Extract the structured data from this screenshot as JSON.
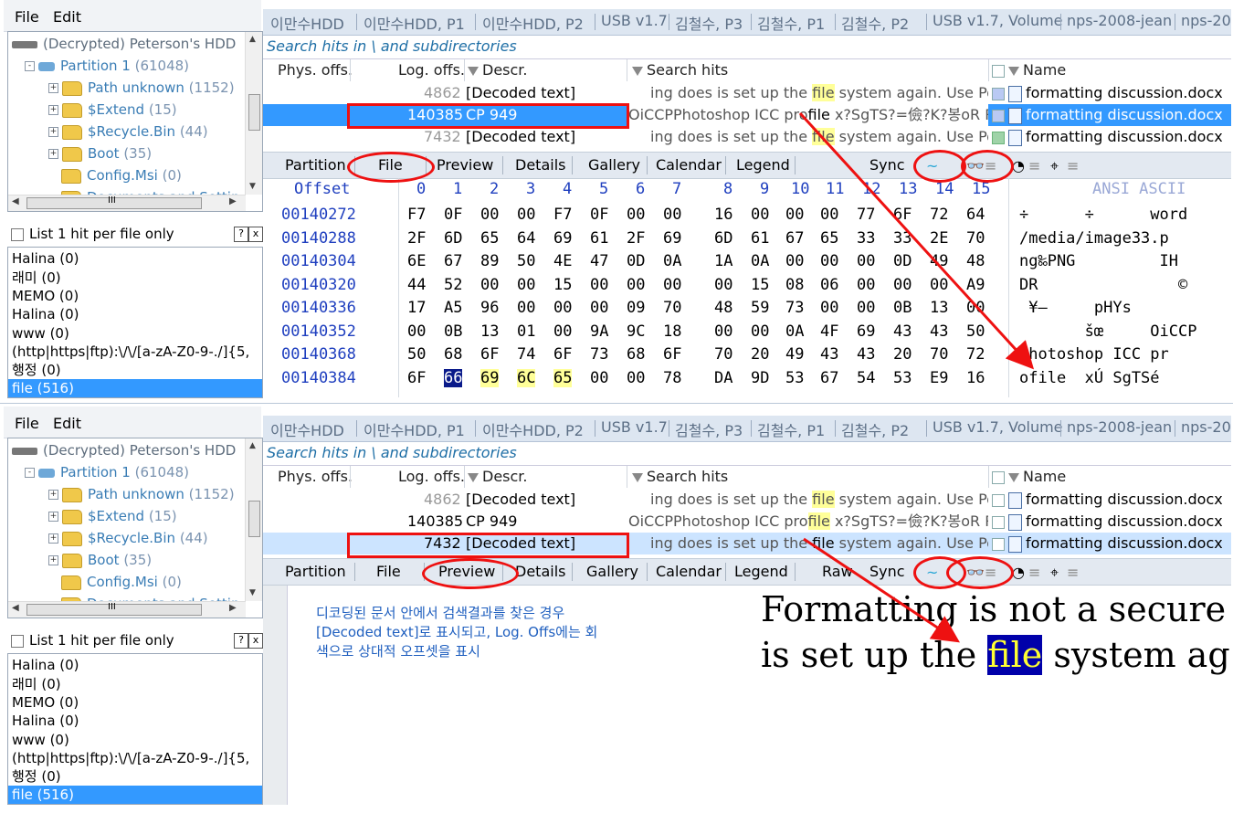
{
  "menu": {
    "file": "File",
    "edit": "Edit"
  },
  "tree": {
    "items": [
      {
        "label": "(Decrypted) Peterson's HDD",
        "count": ""
      },
      {
        "label": "Partition 1",
        "count": "(61048)"
      },
      {
        "label": "Path unknown",
        "count": "(1152)"
      },
      {
        "label": "$Extend",
        "count": "(15)"
      },
      {
        "label": "$Recycle.Bin",
        "count": "(44)"
      },
      {
        "label": "Boot",
        "count": "(35)"
      },
      {
        "label": "Config.Msi",
        "count": "(0)"
      },
      {
        "label": "Documents and Settin",
        "count": ""
      }
    ],
    "hscroll_label": "III"
  },
  "options": {
    "list_one_hit": "List 1 hit per file only",
    "help": "?",
    "close": "x"
  },
  "terms": [
    "Halina (0)",
    "래미 (0)",
    "MEMO (0)",
    "Halina (0)",
    "www (0)",
    "(http|https|ftp):\\/\\/[a-zA-Z0-9-./]{5,",
    "행정 (0)",
    "file (516)"
  ],
  "tabs": [
    "이만수HDD",
    "이만수HDD, P1",
    "이만수HDD, P2",
    "USB v1.7",
    "김철수, P3",
    "김철수, P1",
    "김철수, P2",
    "USB v1.7, Volume",
    "nps-2008-jean",
    "nps-20"
  ],
  "search_title": "Search hits in \\ and subdirectories",
  "columns": {
    "phys": "Phys. offs.",
    "log": "Log. offs.",
    "descr": "Descr.",
    "hits": "Search hits",
    "name": "Name"
  },
  "hits": [
    {
      "log": "4862",
      "descr": "[Decoded text]",
      "pre": "ing does is set up the ",
      "term": "file",
      "post": " system again.  Use Powe",
      "name": "formatting discussion.docx"
    },
    {
      "log": "140385",
      "descr": "CP 949",
      "pre": "OiCCPPhotoshop ICC pro",
      "term": "file",
      "post": "  x?SgTS?=儉?K?봉oR   R",
      "name": "formatting discussion.docx"
    },
    {
      "log": "7432",
      "descr": "[Decoded text]",
      "pre": "ing does is set up the ",
      "term": "file",
      "post": " system again.  Use Powe",
      "name": "formatting discussion.docx"
    }
  ],
  "view_tabs": [
    "Partition",
    "File",
    "Preview",
    "Details",
    "Gallery",
    "Calendar",
    "Legend",
    "Raw",
    "Sync"
  ],
  "hex": {
    "offset_label": "Offset",
    "columns": [
      "0",
      "1",
      "2",
      "3",
      "4",
      "5",
      "6",
      "7",
      "8",
      "9",
      "10",
      "11",
      "12",
      "13",
      "14",
      "15"
    ],
    "ascii_label": "ANSI ASCII",
    "rows": [
      {
        "offset": "00140272",
        "bytes": [
          "F7",
          "0F",
          "00",
          "00",
          "F7",
          "0F",
          "00",
          "00",
          "16",
          "00",
          "00",
          "00",
          "77",
          "6F",
          "72",
          "64"
        ],
        "ascii": "÷      ÷      word"
      },
      {
        "offset": "00140288",
        "bytes": [
          "2F",
          "6D",
          "65",
          "64",
          "69",
          "61",
          "2F",
          "69",
          "6D",
          "61",
          "67",
          "65",
          "33",
          "33",
          "2E",
          "70"
        ],
        "ascii": "/media/image33.p"
      },
      {
        "offset": "00140304",
        "bytes": [
          "6E",
          "67",
          "89",
          "50",
          "4E",
          "47",
          "0D",
          "0A",
          "1A",
          "0A",
          "00",
          "00",
          "00",
          "0D",
          "49",
          "48"
        ],
        "ascii": "ng‰PNG         IH"
      },
      {
        "offset": "00140320",
        "bytes": [
          "44",
          "52",
          "00",
          "00",
          "15",
          "00",
          "00",
          "00",
          "00",
          "15",
          "08",
          "06",
          "00",
          "00",
          "00",
          "A9"
        ],
        "ascii": "DR               ©"
      },
      {
        "offset": "00140336",
        "bytes": [
          "17",
          "A5",
          "96",
          "00",
          "00",
          "00",
          "09",
          "70",
          "48",
          "59",
          "73",
          "00",
          "00",
          "0B",
          "13",
          "00"
        ],
        "ascii": " ¥–     pHYs"
      },
      {
        "offset": "00140352",
        "bytes": [
          "00",
          "0B",
          "13",
          "01",
          "00",
          "9A",
          "9C",
          "18",
          "00",
          "00",
          "0A",
          "4F",
          "69",
          "43",
          "43",
          "50"
        ],
        "ascii": "       šœ     OiCCP"
      },
      {
        "offset": "00140368",
        "bytes": [
          "50",
          "68",
          "6F",
          "74",
          "6F",
          "73",
          "68",
          "6F",
          "70",
          "20",
          "49",
          "43",
          "43",
          "20",
          "70",
          "72"
        ],
        "ascii": "Photoshop ICC pr"
      },
      {
        "offset": "00140384",
        "bytes": [
          "6F",
          "66",
          "69",
          "6C",
          "65",
          "00",
          "00",
          "78",
          "DA",
          "9D",
          "53",
          "67",
          "54",
          "53",
          "E9",
          "16"
        ],
        "ascii": "ofile  xÚ SgTSé"
      }
    ]
  },
  "preview": {
    "note_line1": "디코딩된 문서 안에서 검색결과를 찾은 경우",
    "note_line2": "[Decoded text]로 표시되고, Log. Offs에는 회",
    "note_line3": "색으로 상대적 오프셋을 표시",
    "doc_line1": "Formatting is not a secure wa",
    "doc_line2_pre": "is set up the ",
    "doc_line2_term": "file",
    "doc_line2_post": " system again"
  },
  "colors": {
    "accent": "#3399ff",
    "annotation": "#ee1111",
    "hit_highlight": "#ffff99"
  }
}
